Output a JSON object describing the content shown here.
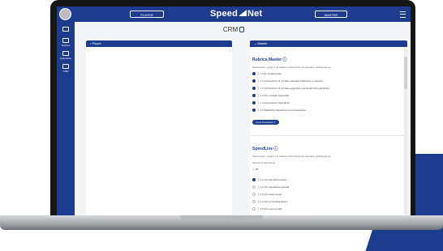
{
  "header": {
    "player_label": "PLAYER",
    "master_label": "MASTER",
    "logo_left": "Speed",
    "logo_right": "Net"
  },
  "sidebar": {
    "items": [
      {
        "label": "",
        "icon": "user-icon"
      },
      {
        "label": "Rubrica",
        "icon": "contacts-icon"
      },
      {
        "label": "SpeedLive",
        "icon": "crown-icon"
      },
      {
        "label": "CRM",
        "icon": "database-icon"
      }
    ]
  },
  "page": {
    "title": "CRM"
  },
  "left_panel": {
    "title": "Player"
  },
  "right_panel": {
    "title": "Master",
    "rubrica": {
      "title": "Rubrica Master",
      "desc": "Selezionare i gruppi o le relative informazioni da includere nell'anteprima",
      "options": [
        {
          "text": "1 Info contatto base",
          "on": true
        },
        {
          "text": "1.1 Informazioni di contatto standard pubblicate o presenti",
          "on": true
        },
        {
          "text": "1.2 Informazioni di contatto aggiuntive personalizzate pubblicate",
          "on": true
        },
        {
          "text": "1.3 Info contatto SpeedNet",
          "on": true
        },
        {
          "text": "1.4 Informazioni SpeedLive",
          "on": true
        },
        {
          "text": "1.5 Statistiche SpeedLive per partecipante",
          "on": true
        }
      ],
      "button": "Avvia Download"
    },
    "speedlive": {
      "title": "SpeedLive",
      "desc": "Selezionare i gruppi o le relative informazioni da includere nell'anteprima",
      "sub_label": "Seleziona SpeedLive",
      "sub_value": "28",
      "options": [
        {
          "text": "2.1 Info SpeedLive base",
          "on": true
        },
        {
          "text": "2.2 Info SpeedLive giocata",
          "on": false
        },
        {
          "text": "2.3 Info setup setup",
          "on": false
        },
        {
          "text": "2.4 Info personalizzazioni",
          "on": false
        },
        {
          "text": "2.5 Info evento finali",
          "on": false
        }
      ]
    }
  },
  "colors": {
    "brand": "#1d3c8f",
    "background": "#f4f5f7"
  }
}
